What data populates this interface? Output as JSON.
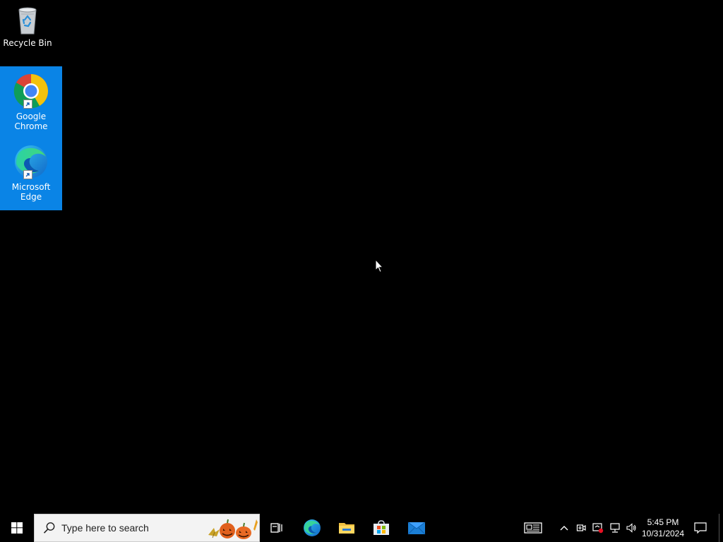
{
  "desktop": {
    "icons": [
      {
        "label": "Recycle Bin",
        "icon": "recycle-bin-icon"
      },
      {
        "label": "Google Chrome",
        "icon": "chrome-icon"
      },
      {
        "label": "Microsoft Edge",
        "icon": "edge-icon"
      }
    ]
  },
  "taskbar": {
    "search_placeholder": "Type here to search",
    "apps": [
      {
        "name": "Task View",
        "icon": "task-view-icon"
      },
      {
        "name": "Microsoft Edge",
        "icon": "edge-icon"
      },
      {
        "name": "File Explorer",
        "icon": "folder-icon"
      },
      {
        "name": "Microsoft Store",
        "icon": "store-icon"
      },
      {
        "name": "Mail",
        "icon": "mail-icon"
      }
    ],
    "tray": {
      "time": "5:45 PM",
      "date": "10/31/2024"
    }
  },
  "colors": {
    "selection": "#0a84e6",
    "taskbar": "#000000",
    "search_bg": "#f3f3f3"
  }
}
